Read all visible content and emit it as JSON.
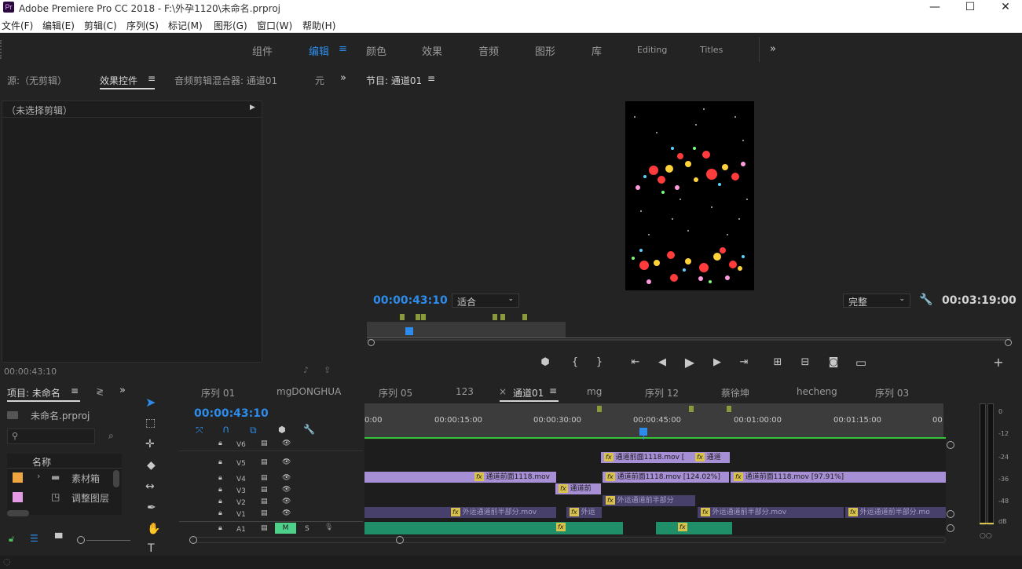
{
  "window": {
    "title": "Adobe Premiere Pro CC 2018 - F:\\外孕1120\\未命名.prproj",
    "logo": "Pr",
    "minimize": "—",
    "maximize": "☐",
    "close": "✕"
  },
  "menu": [
    "文件(F)",
    "编辑(E)",
    "剪辑(C)",
    "序列(S)",
    "标记(M)",
    "图形(G)",
    "窗口(W)",
    "帮助(H)"
  ],
  "workspaces": [
    {
      "label": "组件"
    },
    {
      "label": "编辑",
      "active": true
    },
    {
      "label": "颜色"
    },
    {
      "label": "效果"
    },
    {
      "label": "音频"
    },
    {
      "label": "图形"
    },
    {
      "label": "库"
    },
    {
      "label": "Editing"
    },
    {
      "label": "Titles"
    }
  ],
  "workspace_menu": "≡",
  "workspace_more": "»",
  "source_panel": {
    "tabs": [
      "源:（无剪辑）",
      "效果控件",
      "音频剪辑混合器: 通道01",
      "元"
    ],
    "more": "»",
    "no_clip": "（未选择剪辑）",
    "timecode": "00:00:43:10"
  },
  "program": {
    "title": "节目: 通道01",
    "timecode": "00:00:43:10",
    "fit": "适合",
    "quality": "完整",
    "duration": "00:03:19:00",
    "add": "+"
  },
  "project": {
    "tabs": [
      "项目: 未命名",
      "≷"
    ],
    "more": "»",
    "file": "未命名.prproj",
    "col_name": "名称",
    "items": [
      {
        "name": "素材箱",
        "color": "#f0a640"
      },
      {
        "name": "调整图层",
        "color": "#e59ae6"
      }
    ]
  },
  "timeline": {
    "tabs": [
      "序列 01",
      "mgDONGHUA",
      "序列 05",
      "123",
      "通道01",
      "mg",
      "序列 12",
      "蔡徐坤",
      "hecheng",
      "序列 03"
    ],
    "close": "×",
    "active_index": 4,
    "timecode": "00:00:43:10",
    "ruler": [
      "0:00",
      "00:00:15:00",
      "00:00:30:00",
      "00:00:45:00",
      "00:01:00:00",
      "00:01:15:00",
      "00:0"
    ],
    "tracks": [
      "V6",
      "V5",
      "V4",
      "V3",
      "V2",
      "V1",
      "A1"
    ],
    "mute": "M",
    "solo": "S",
    "clips": {
      "v5a": "通道前面1118.mov [",
      "v5b": "通道",
      "v4a": "通道前面1118.mov",
      "v4b": "通道前面1118.mov [124.02%]",
      "v4c": "通道前面1118.mov [97.91%]",
      "v3a": "通道前",
      "v2a": "外运通道前半部分",
      "v1a": "外运通道前半部分.mov",
      "v1b": "外运",
      "v1c": "外运通道前半部分.mov",
      "v1d": "外运通道前半部分.mo"
    },
    "fx": "fx"
  },
  "meter": {
    "scale": [
      "0",
      "-12",
      "-24",
      "-36",
      "-48",
      "dB"
    ]
  }
}
